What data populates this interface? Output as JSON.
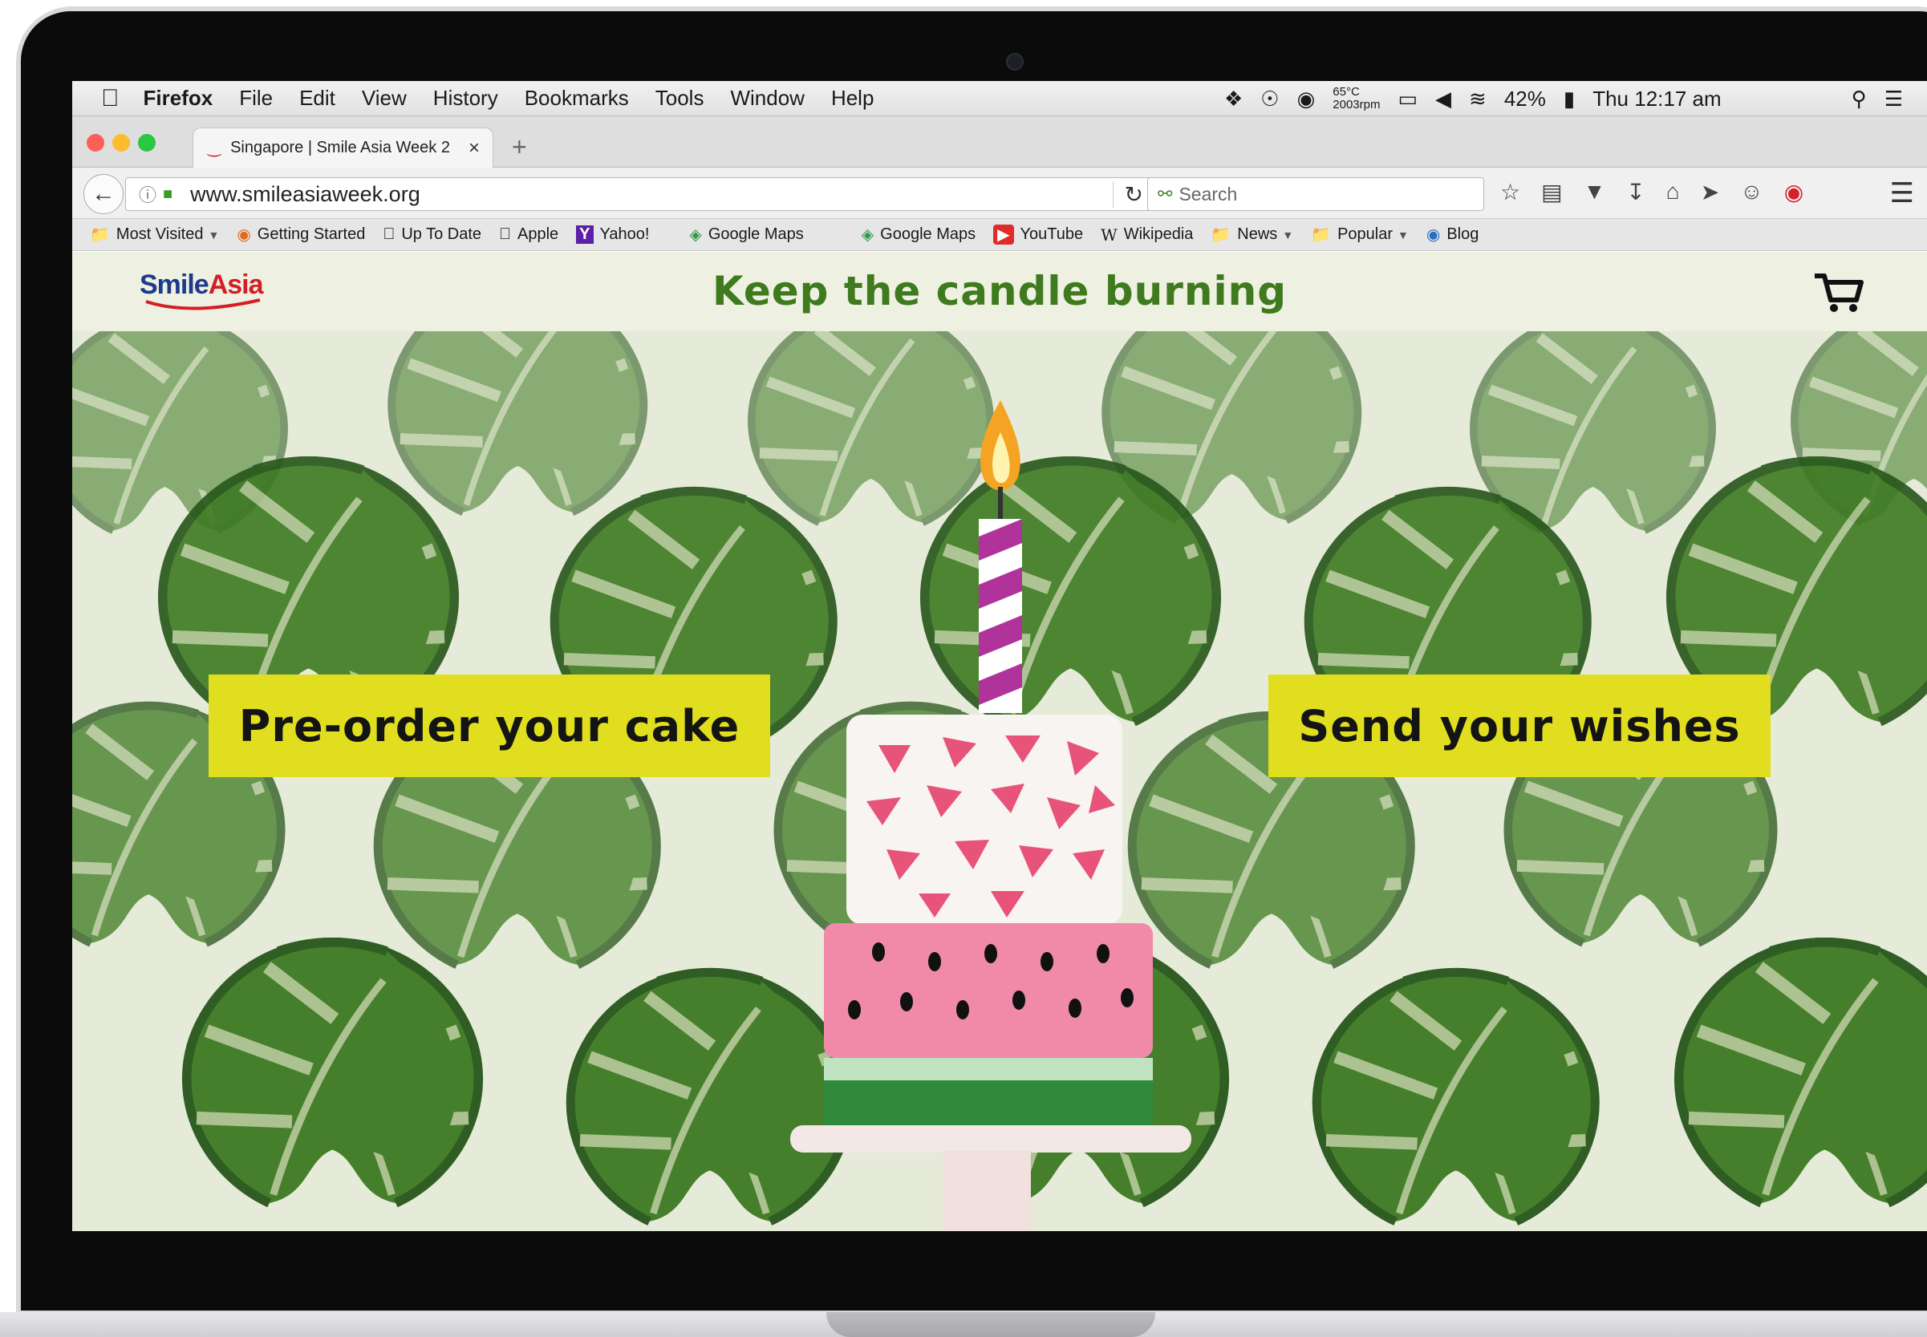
{
  "menubar": {
    "app": "Firefox",
    "items": [
      "File",
      "Edit",
      "View",
      "History",
      "Bookmarks",
      "Tools",
      "Window",
      "Help"
    ],
    "temp_line1": "65°C",
    "temp_line2": "2003rpm",
    "battery": "42%",
    "clock": "Thu 12:17 am"
  },
  "tab": {
    "title": "Singapore | Smile Asia Week 2",
    "close": "×",
    "new_tab": "+"
  },
  "nav": {
    "url": "www.smileasiaweek.org",
    "search_placeholder": "Search"
  },
  "bookmarks": [
    {
      "label": "Most Visited",
      "icon": "folder-icon",
      "caret": true
    },
    {
      "label": "Getting Started",
      "icon": "firefox-icon",
      "caret": false
    },
    {
      "label": "Up To Date",
      "icon": "apple-icon",
      "caret": false
    },
    {
      "label": "Apple",
      "icon": "apple-icon",
      "caret": false
    },
    {
      "label": "Yahoo!",
      "icon": "yahoo-icon",
      "caret": false
    },
    {
      "label": "Google Maps",
      "icon": "maps-icon",
      "caret": false
    },
    {
      "label": "Google Maps",
      "icon": "maps-icon",
      "caret": false
    },
    {
      "label": "YouTube",
      "icon": "youtube-icon",
      "caret": false
    },
    {
      "label": "Wikipedia",
      "icon": "wikipedia-icon",
      "caret": false
    },
    {
      "label": "News",
      "icon": "folder-icon",
      "caret": true
    },
    {
      "label": "Popular",
      "icon": "folder-icon",
      "caret": true
    },
    {
      "label": "Blog",
      "icon": "wordpress-icon",
      "caret": false
    }
  ],
  "site": {
    "logo_smile": "Smile",
    "logo_asia": "Asia",
    "title": "Keep the candle burning",
    "cta_left": "Pre-order your cake",
    "cta_right": "Send your wishes"
  },
  "colors": {
    "title_green": "#3f7b1e",
    "cta_yellow": "#e0de1f",
    "leaf_green": "#3d7a22",
    "watermelon_pink": "#f08aa8"
  }
}
